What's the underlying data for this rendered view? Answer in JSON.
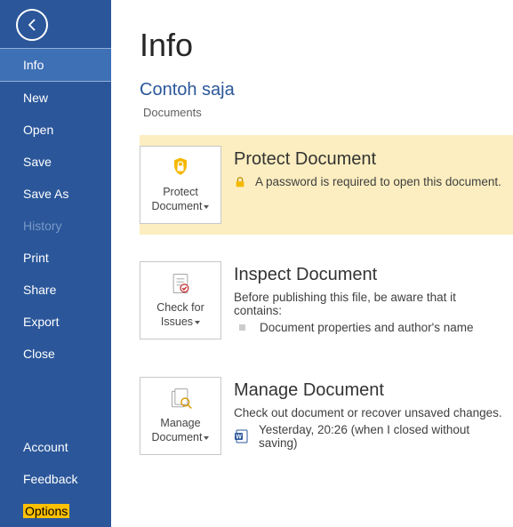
{
  "sidebar": {
    "items": [
      {
        "label": "Info",
        "state": "active"
      },
      {
        "label": "New"
      },
      {
        "label": "Open"
      },
      {
        "label": "Save"
      },
      {
        "label": "Save As"
      },
      {
        "label": "History",
        "state": "disabled"
      },
      {
        "label": "Print"
      },
      {
        "label": "Share"
      },
      {
        "label": "Export"
      },
      {
        "label": "Close"
      }
    ],
    "bottom_items": [
      {
        "label": "Account"
      },
      {
        "label": "Feedback"
      },
      {
        "label": "Options",
        "state": "highlight"
      }
    ]
  },
  "page": {
    "title": "Info",
    "doc_title": "Contoh saja",
    "doc_location": "Documents"
  },
  "protect": {
    "button_label": "Protect Document",
    "heading": "Protect Document",
    "text": "A password is required to open this document."
  },
  "inspect": {
    "button_label": "Check for Issues",
    "heading": "Inspect Document",
    "text": "Before publishing this file, be aware that it contains:",
    "item1": "Document properties and author's name"
  },
  "manage": {
    "button_label": "Manage Document",
    "heading": "Manage Document",
    "text": "Check out document or recover unsaved changes.",
    "item1": "Yesterday, 20:26 (when I closed without saving)"
  }
}
